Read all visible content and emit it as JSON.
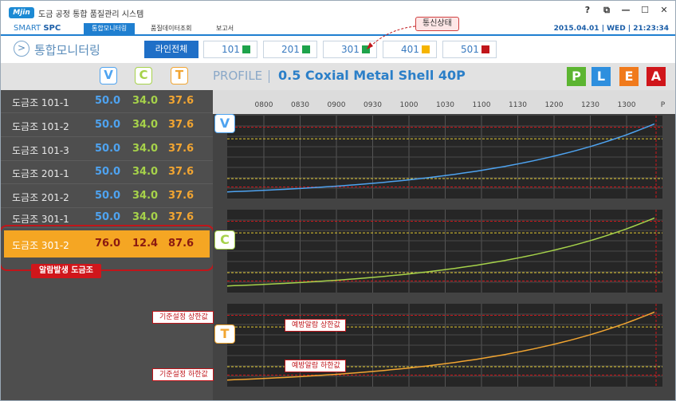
{
  "app": {
    "logo_text": "Mjin",
    "title": "도금 공정 통합 품질관리 시스템",
    "controls": [
      "?",
      "⧉",
      "—",
      "☐",
      "✕"
    ]
  },
  "menu": {
    "brand_prefix": "SMART",
    "brand_suffix": "SPC",
    "tabs": [
      {
        "label": "통합모니터링",
        "active": true
      },
      {
        "label": "품질데이터조회",
        "active": false
      },
      {
        "label": "보고서",
        "active": false
      }
    ],
    "datetime": "2015.04.01 | WED | 21:23:34"
  },
  "header": {
    "nav_glyph": ">",
    "page_title": "통합모니터링",
    "line_all": "라인전체",
    "lines": [
      {
        "label": "101",
        "color": "#1ea34b"
      },
      {
        "label": "201",
        "color": "#1ea34b"
      },
      {
        "label": "301",
        "color": "#1ea34b"
      },
      {
        "label": "401",
        "color": "#f5b400"
      },
      {
        "label": "501",
        "color": "#c0161b"
      }
    ],
    "comm_callout": "통신상태"
  },
  "vct": {
    "badges": [
      {
        "label": "V",
        "color": "#4ea3f0"
      },
      {
        "label": "C",
        "color": "#a6d24a"
      },
      {
        "label": "T",
        "color": "#f2a531"
      }
    ],
    "rows": [
      {
        "name": "도금조 101-1",
        "v": "50.0",
        "c": "34.0",
        "t": "37.6",
        "alarm": false
      },
      {
        "name": "도금조 101-2",
        "v": "50.0",
        "c": "34.0",
        "t": "37.6",
        "alarm": false
      },
      {
        "name": "도금조 101-3",
        "v": "50.0",
        "c": "34.0",
        "t": "37.6",
        "alarm": false
      },
      {
        "name": "도금조 201-1",
        "v": "50.0",
        "c": "34.0",
        "t": "37.6",
        "alarm": false
      },
      {
        "name": "도금조 201-2",
        "v": "50.0",
        "c": "34.0",
        "t": "37.6",
        "alarm": false
      },
      {
        "name": "도금조 301-1",
        "v": "50.0",
        "c": "34.0",
        "t": "37.6",
        "alarm": false
      },
      {
        "name": "도금조 301-2",
        "v": "76.0",
        "c": "12.4",
        "t": "87.6",
        "alarm": true
      }
    ],
    "alarm_label": "알람발생 도금조"
  },
  "profile": {
    "label": "PROFILE",
    "name": "0.5 Coxial Metal Shell 40P",
    "plea": [
      {
        "label": "P",
        "color": "#5cb531"
      },
      {
        "label": "L",
        "color": "#2e8fde"
      },
      {
        "label": "E",
        "color": "#f07a1c"
      },
      {
        "label": "A",
        "color": "#d0161b"
      }
    ]
  },
  "chart_data": {
    "type": "line",
    "x": [
      "0800",
      "0830",
      "0900",
      "0930",
      "1000",
      "1030",
      "1100",
      "1130",
      "1200",
      "1230",
      "1300",
      "P"
    ],
    "series": [
      {
        "name": "V",
        "color": "#4ea3f0",
        "trend": "exponential rise",
        "start_frac": 0.08,
        "end_frac": 0.9
      },
      {
        "name": "C",
        "color": "#a6d24a",
        "trend": "exponential rise",
        "start_frac": 0.08,
        "end_frac": 0.9
      },
      {
        "name": "T",
        "color": "#f2a531",
        "trend": "exponential rise",
        "start_frac": 0.08,
        "end_frac": 0.9
      }
    ],
    "annotations": {
      "upper_base": "기준설정 상한값",
      "upper_warn": "예방알람 상한값",
      "lower_warn": "예방알람 하한값",
      "lower_base": "기준설정 하한값"
    }
  }
}
